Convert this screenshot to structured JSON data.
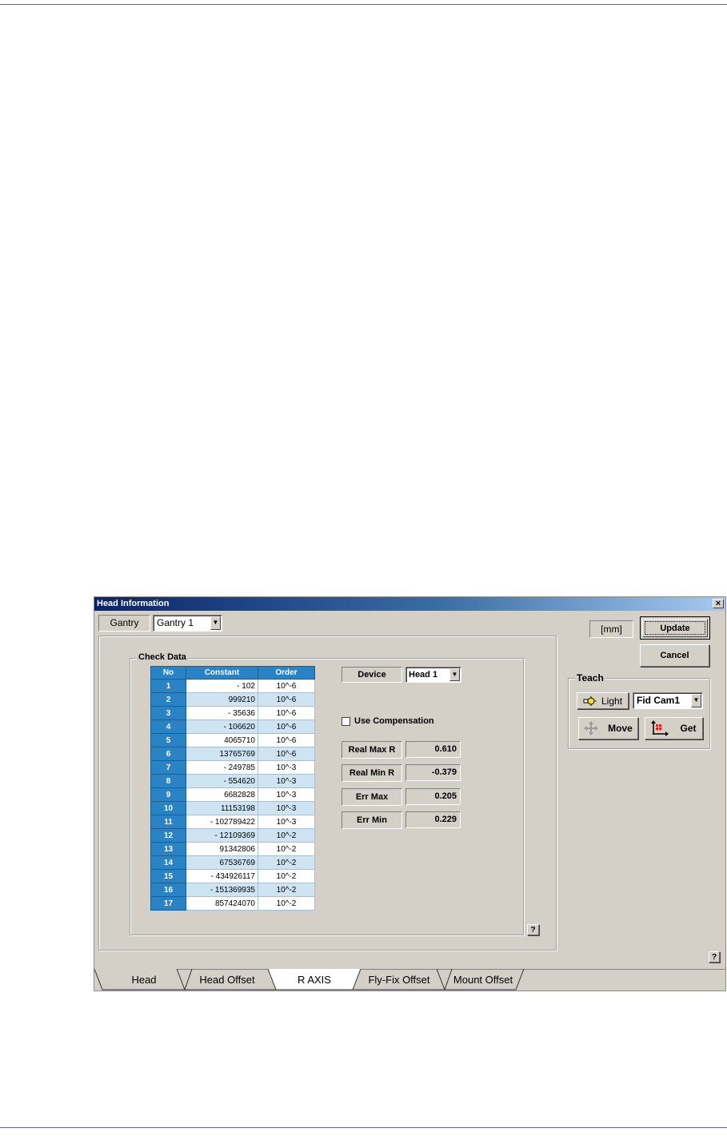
{
  "window": {
    "title": "Head Information",
    "close_glyph": "×"
  },
  "gantry": {
    "label": "Gantry",
    "value": "Gantry 1"
  },
  "unit": "[mm]",
  "buttons": {
    "update": "Update",
    "cancel": "Cancel"
  },
  "teach": {
    "title": "Teach",
    "light_label": "Light",
    "camera_value": "Fid Cam1",
    "move_label": "Move",
    "get_label": "Get"
  },
  "check_data": {
    "title": "Check Data",
    "columns": [
      "No",
      "Constant",
      "Order"
    ],
    "rows": [
      {
        "no": "1",
        "constant": "- 102",
        "order": "10^-6"
      },
      {
        "no": "2",
        "constant": "999210",
        "order": "10^-6"
      },
      {
        "no": "3",
        "constant": "- 35636",
        "order": "10^-6"
      },
      {
        "no": "4",
        "constant": "- 106620",
        "order": "10^-6"
      },
      {
        "no": "5",
        "constant": "4065710",
        "order": "10^-6"
      },
      {
        "no": "6",
        "constant": "13765769",
        "order": "10^-6"
      },
      {
        "no": "7",
        "constant": "- 249785",
        "order": "10^-3"
      },
      {
        "no": "8",
        "constant": "- 554620",
        "order": "10^-3"
      },
      {
        "no": "9",
        "constant": "6682828",
        "order": "10^-3"
      },
      {
        "no": "10",
        "constant": "11153198",
        "order": "10^-3"
      },
      {
        "no": "11",
        "constant": "- 102789422",
        "order": "10^-3"
      },
      {
        "no": "12",
        "constant": "- 12109369",
        "order": "10^-2"
      },
      {
        "no": "13",
        "constant": "91342806",
        "order": "10^-2"
      },
      {
        "no": "14",
        "constant": "67536769",
        "order": "10^-2"
      },
      {
        "no": "15",
        "constant": "- 434926117",
        "order": "10^-2"
      },
      {
        "no": "16",
        "constant": "- 151369935",
        "order": "10^-2"
      },
      {
        "no": "17",
        "constant": "857424070",
        "order": "10^-2"
      }
    ],
    "device_label": "Device",
    "device_value": "Head 1",
    "use_compensation_label": "Use Compensation",
    "values": [
      {
        "label": "Real Max R",
        "value": "0.610"
      },
      {
        "label": "Real Min R",
        "value": "-0.379"
      },
      {
        "label": "Err Max",
        "value": "0.205"
      },
      {
        "label": "Err Min",
        "value": "0.229"
      }
    ],
    "help": "?"
  },
  "help": "?",
  "tabs": [
    {
      "label": "Head"
    },
    {
      "label": "Head Offset"
    },
    {
      "label": "R AXIS"
    },
    {
      "label": "Fly-Fix Offset"
    },
    {
      "label": "Mount Offset"
    }
  ],
  "active_tab": "R AXIS"
}
